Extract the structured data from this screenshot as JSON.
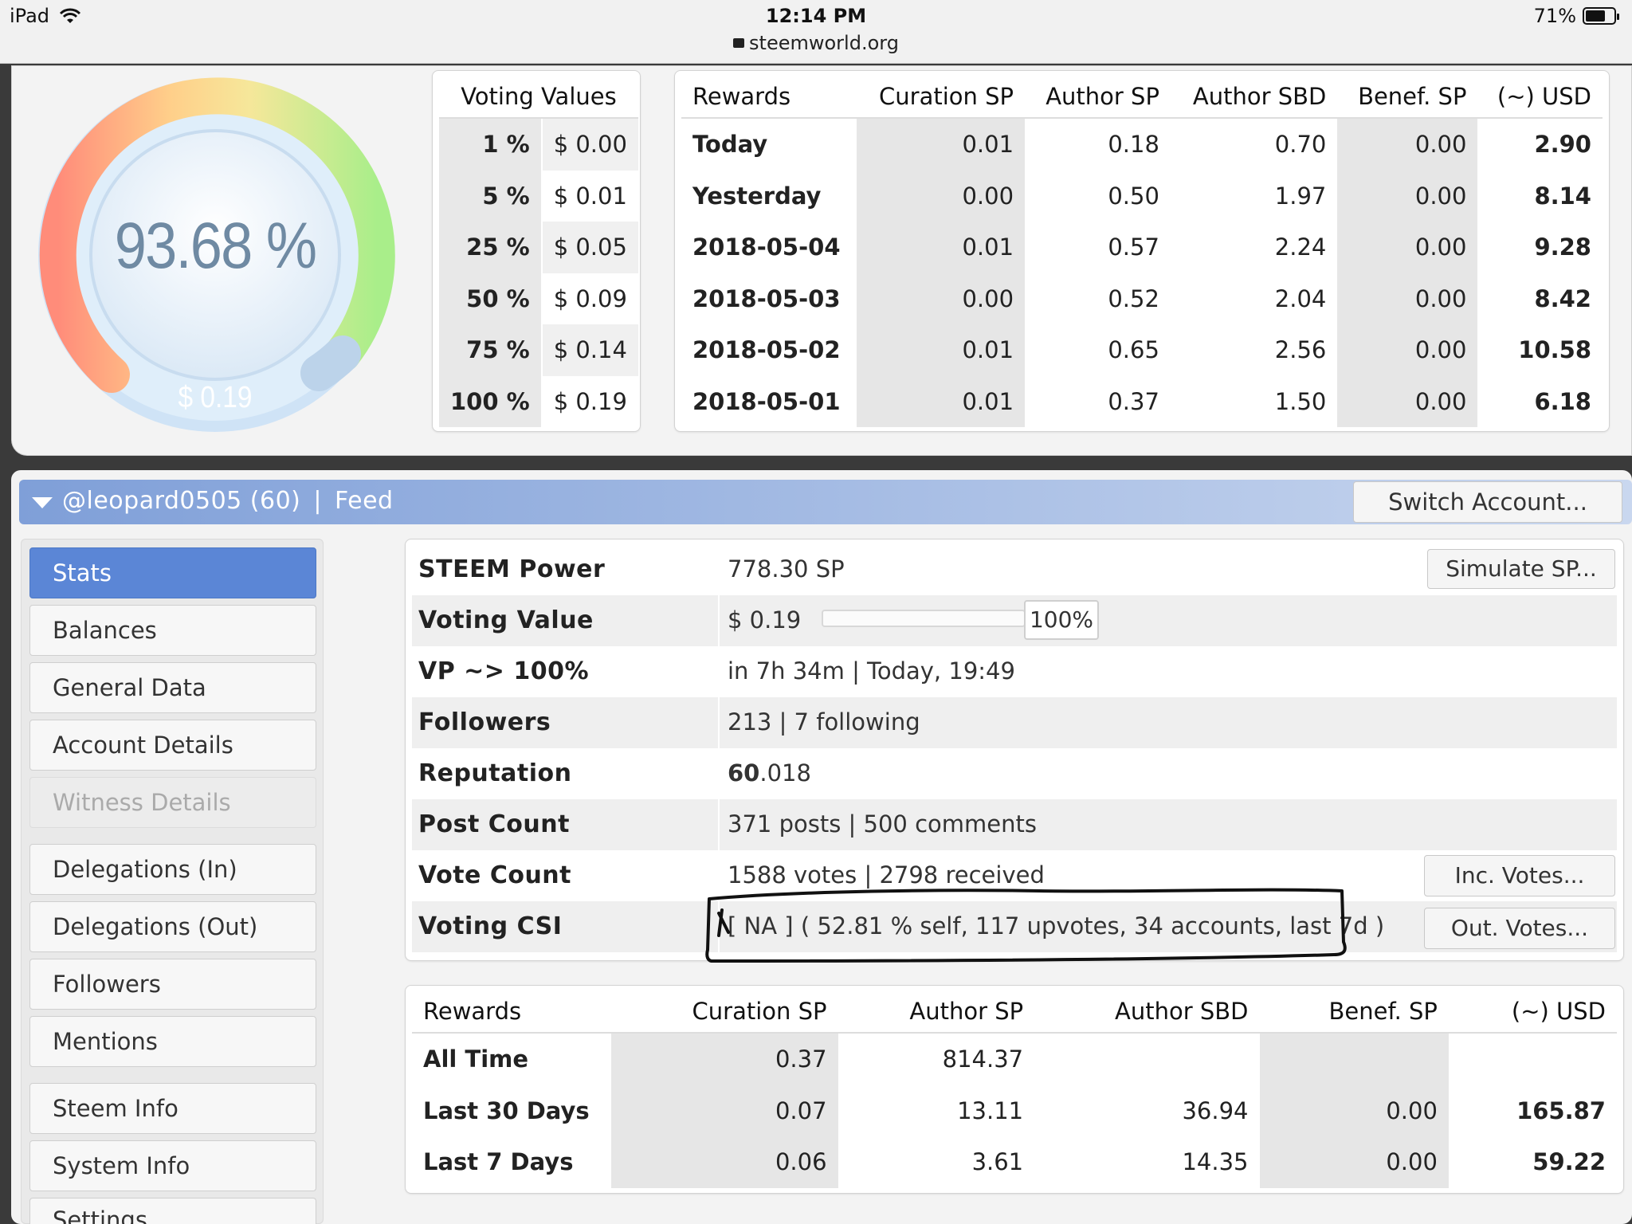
{
  "status_bar": {
    "device": "iPad",
    "time": "12:14 PM",
    "url": "steemworld.org",
    "battery": "71%"
  },
  "gauge": {
    "percent_text": "93.68 %",
    "usd_text": "$ 0.19",
    "value_fraction": 0.9368
  },
  "voting_values": {
    "header": "Voting Values",
    "rows": [
      {
        "pct": "1 %",
        "usd": "$ 0.00"
      },
      {
        "pct": "5 %",
        "usd": "$ 0.01"
      },
      {
        "pct": "25 %",
        "usd": "$ 0.05"
      },
      {
        "pct": "50 %",
        "usd": "$ 0.09"
      },
      {
        "pct": "75 %",
        "usd": "$ 0.14"
      },
      {
        "pct": "100 %",
        "usd": "$ 0.19"
      }
    ]
  },
  "rewards_top": {
    "headers": [
      "Rewards",
      "Curation SP",
      "Author SP",
      "Author SBD",
      "Benef. SP",
      "(~) USD"
    ],
    "rows": [
      [
        "Today",
        "0.01",
        "0.18",
        "0.70",
        "0.00",
        "2.90"
      ],
      [
        "Yesterday",
        "0.00",
        "0.50",
        "1.97",
        "0.00",
        "8.14"
      ],
      [
        "2018-05-04",
        "0.01",
        "0.57",
        "2.24",
        "0.00",
        "9.28"
      ],
      [
        "2018-05-03",
        "0.00",
        "0.52",
        "2.04",
        "0.00",
        "8.42"
      ],
      [
        "2018-05-02",
        "0.01",
        "0.65",
        "2.56",
        "0.00",
        "10.58"
      ],
      [
        "2018-05-01",
        "0.01",
        "0.37",
        "1.50",
        "0.00",
        "6.18"
      ]
    ]
  },
  "account_bar": {
    "account": "@leopard0505 (60)",
    "separator": "|",
    "feed": "Feed",
    "switch_label": "Switch Account..."
  },
  "sidebar": {
    "items": [
      {
        "label": "Stats",
        "state": "active"
      },
      {
        "label": "Balances",
        "state": "normal"
      },
      {
        "label": "General Data",
        "state": "normal"
      },
      {
        "label": "Account Details",
        "state": "normal"
      },
      {
        "label": "Witness Details",
        "state": "disabled"
      },
      {
        "label": "Delegations (In)",
        "state": "normal"
      },
      {
        "label": "Delegations (Out)",
        "state": "normal"
      },
      {
        "label": "Followers",
        "state": "normal"
      },
      {
        "label": "Mentions",
        "state": "normal"
      },
      {
        "label": "Steem Info",
        "state": "normal"
      },
      {
        "label": "System Info",
        "state": "normal"
      },
      {
        "label": "Settings",
        "state": "normal"
      }
    ]
  },
  "stats": {
    "steem_power": {
      "label": "STEEM Power",
      "value": "778.30 SP",
      "button": "Simulate SP..."
    },
    "voting_value": {
      "label": "Voting Value",
      "value": "$ 0.19",
      "pct": "100%"
    },
    "vp_full": {
      "label": "VP ~> 100%",
      "value": "in 7h 34m | Today, 19:49"
    },
    "followers": {
      "label": "Followers",
      "value": "213 | 7 following"
    },
    "reputation": {
      "label": "Reputation",
      "value_main": "60",
      "value_rest": ".018"
    },
    "post_count": {
      "label": "Post Count",
      "value": "371 posts | 500 comments"
    },
    "vote_count": {
      "label": "Vote Count",
      "value": "1588 votes | 2798 received",
      "button": "Inc. Votes..."
    },
    "voting_csi": {
      "label": "Voting CSI",
      "value": "[ NA ] ( 52.81 % self, 117 upvotes, 34 accounts, last 7d )",
      "button": "Out. Votes..."
    }
  },
  "rewards_bottom": {
    "headers": [
      "Rewards",
      "Curation SP",
      "Author SP",
      "Author SBD",
      "Benef. SP",
      "(~) USD"
    ],
    "rows": [
      [
        "All Time",
        "0.37",
        "814.37",
        "",
        "",
        ""
      ],
      [
        "Last 30 Days",
        "0.07",
        "13.11",
        "36.94",
        "0.00",
        "165.87"
      ],
      [
        "Last 7 Days",
        "0.06",
        "3.61",
        "14.35",
        "0.00",
        "59.22"
      ]
    ]
  },
  "colors": {
    "accent_blue": "#5b86d6",
    "gauge_text": "#6f8aa3"
  }
}
